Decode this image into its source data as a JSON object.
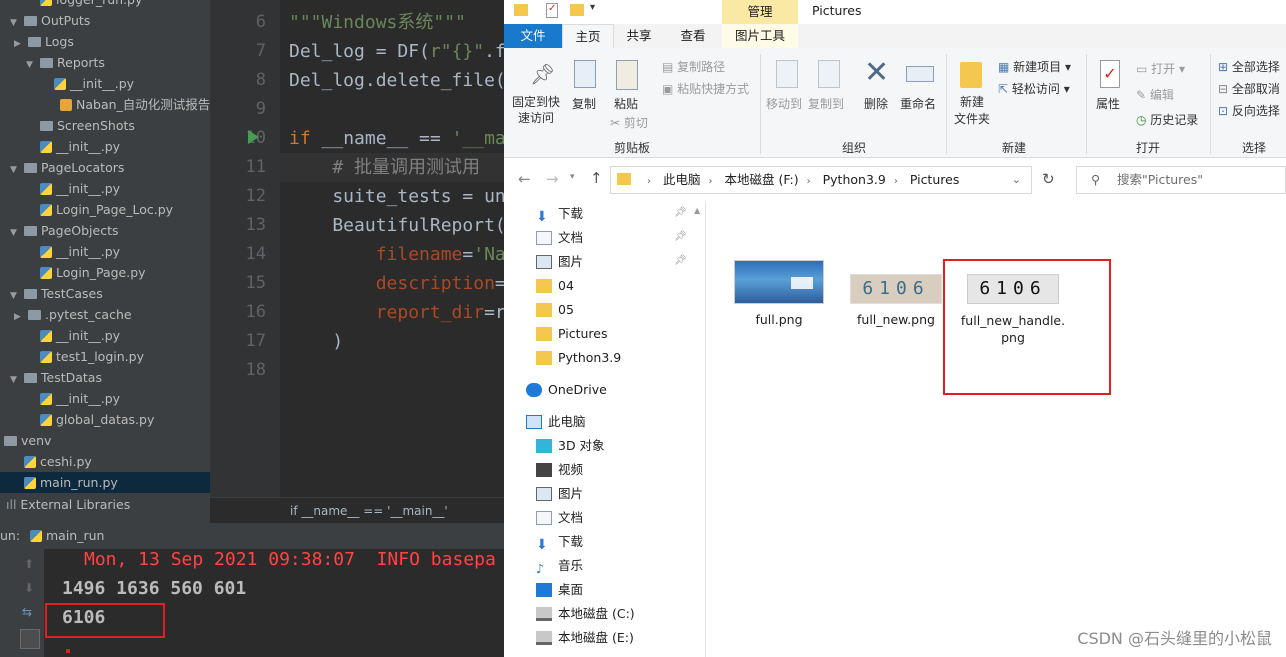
{
  "ide": {
    "tree": [
      {
        "label": "logger_run.py",
        "kind": "py"
      },
      {
        "label": "OutPuts",
        "kind": "folder",
        "arrow": "▼"
      },
      {
        "label": "Logs",
        "kind": "folder",
        "arrow": "▶"
      },
      {
        "label": "Reports",
        "kind": "folder",
        "arrow": "▼"
      },
      {
        "label": "__init__.py",
        "kind": "py"
      },
      {
        "label": "Naban_自动化测试报告.h",
        "kind": "file"
      },
      {
        "label": "ScreenShots",
        "kind": "folder"
      },
      {
        "label": "__init__.py",
        "kind": "py"
      },
      {
        "label": "PageLocators",
        "kind": "folder",
        "arrow": "▼"
      },
      {
        "label": "__init__.py",
        "kind": "py"
      },
      {
        "label": "Login_Page_Loc.py",
        "kind": "py"
      },
      {
        "label": "PageObjects",
        "kind": "folder",
        "arrow": "▼"
      },
      {
        "label": "__init__.py",
        "kind": "py"
      },
      {
        "label": "Login_Page.py",
        "kind": "py"
      },
      {
        "label": "TestCases",
        "kind": "folder",
        "arrow": "▼"
      },
      {
        "label": ".pytest_cache",
        "kind": "folder",
        "arrow": "▶"
      },
      {
        "label": "__init__.py",
        "kind": "py"
      },
      {
        "label": "test1_login.py",
        "kind": "py"
      },
      {
        "label": "TestDatas",
        "kind": "folder",
        "arrow": "▼"
      },
      {
        "label": "__init__.py",
        "kind": "py"
      },
      {
        "label": "global_datas.py",
        "kind": "py"
      },
      {
        "label": "venv",
        "kind": "folder",
        "arrow": "▶"
      },
      {
        "label": "ceshi.py",
        "kind": "py"
      },
      {
        "label": "main_run.py",
        "kind": "py",
        "selected": true
      }
    ],
    "external_libraries": "External Libraries",
    "line_numbers": [
      "6",
      "7",
      "8",
      "9",
      "10",
      "11",
      "12",
      "13",
      "14",
      "15",
      "16",
      "17",
      "18"
    ],
    "code_lines": [
      [
        {
          "t": "\"\"\"Windows系统\"\"\"",
          "c": "str"
        }
      ],
      [
        {
          "t": "Del_log = DF(",
          "c": "fn"
        },
        {
          "t": "r\"{}\"",
          "c": "str"
        },
        {
          "t": ".f",
          "c": "fn"
        }
      ],
      [
        {
          "t": "Del_log.delete_file(",
          "c": "fn"
        }
      ],
      [],
      [
        {
          "t": "if ",
          "c": "kw"
        },
        {
          "t": "__name__ == ",
          "c": "fn"
        },
        {
          "t": "'__ma",
          "c": "str"
        }
      ],
      [
        {
          "t": "    # 批量调用测试用",
          "c": "cm"
        }
      ],
      [
        {
          "t": "    suite_tests = un",
          "c": "fn"
        }
      ],
      [
        {
          "t": "    BeautifulReport(",
          "c": "fn"
        }
      ],
      [
        {
          "t": "        ",
          "c": "fn"
        },
        {
          "t": "filename",
          "c": "prm"
        },
        {
          "t": "=",
          "c": "fn"
        },
        {
          "t": "'Na",
          "c": "str"
        }
      ],
      [
        {
          "t": "        ",
          "c": "fn"
        },
        {
          "t": "description",
          "c": "prm"
        },
        {
          "t": "=",
          "c": "fn"
        }
      ],
      [
        {
          "t": "        ",
          "c": "fn"
        },
        {
          "t": "report_dir",
          "c": "prm"
        },
        {
          "t": "=r",
          "c": "fn"
        }
      ],
      [
        {
          "t": "    )",
          "c": "fn"
        }
      ],
      []
    ],
    "breadcrumb": "if __name__ == '__main__'",
    "run_label": "un:",
    "run_tab": "main_run",
    "console": {
      "log_line": "Mon, 13 Sep 2021 09:38:07  INFO basepa",
      "coords_line": "1496 1636 560 601",
      "result_line": "6106"
    }
  },
  "explorer": {
    "manage_tab": "管理",
    "window_title": "Pictures",
    "tabs": [
      "文件",
      "主页",
      "共享",
      "查看",
      "图片工具"
    ],
    "ribbon": {
      "pin": "固定到快\n速访问",
      "copy": "复制",
      "paste": "粘贴",
      "copy_path": "复制路径",
      "paste_shortcut": "粘贴快捷方式",
      "cut": "剪切",
      "move_to": "移动到",
      "copy_to": "复制到",
      "delete": "删除",
      "rename": "重命名",
      "new_folder": "新建\n文件夹",
      "new_item": "新建项目 ▾",
      "easy_access": "轻松访问 ▾",
      "properties": "属性",
      "open": "打开 ▾",
      "edit": "编辑",
      "history": "历史记录",
      "select_all": "全部选择",
      "select_none": "全部取消",
      "invert": "反向选择",
      "groups": [
        "剪贴板",
        "组织",
        "新建",
        "打开",
        "选择"
      ]
    },
    "path": [
      "此电脑",
      "本地磁盘 (F:)",
      "Python3.9",
      "Pictures"
    ],
    "search_placeholder": "搜索\"Pictures\"",
    "nav": [
      {
        "label": "下载",
        "icon": "download-icon",
        "pin": true
      },
      {
        "label": "文档",
        "icon": "document-icon",
        "pin": true
      },
      {
        "label": "图片",
        "icon": "picture-icon",
        "pin": true
      },
      {
        "label": "04",
        "icon": "folder-icon"
      },
      {
        "label": "05",
        "icon": "folder-icon"
      },
      {
        "label": "Pictures",
        "icon": "folder-icon"
      },
      {
        "label": "Python3.9",
        "icon": "folder-icon"
      },
      {
        "label": "OneDrive",
        "icon": "onedrive-icon"
      },
      {
        "label": "此电脑",
        "icon": "computer-icon"
      },
      {
        "label": "3D 对象",
        "icon": "3d-objects-icon"
      },
      {
        "label": "视频",
        "icon": "video-icon"
      },
      {
        "label": "图片",
        "icon": "picture-icon"
      },
      {
        "label": "文档",
        "icon": "document-icon"
      },
      {
        "label": "下载",
        "icon": "download-icon"
      },
      {
        "label": "音乐",
        "icon": "music-icon"
      },
      {
        "label": "桌面",
        "icon": "desktop-icon"
      },
      {
        "label": "本地磁盘 (C:)",
        "icon": "drive-icon"
      },
      {
        "label": "本地磁盘 (E:)",
        "icon": "drive-icon"
      }
    ],
    "files": [
      {
        "name": "full.png"
      },
      {
        "name": "full_new.png",
        "thumb_text": "6106"
      },
      {
        "name": "full_new_handle.\npng",
        "thumb_text": "6106"
      }
    ]
  },
  "watermark": "CSDN @石头缝里的小松鼠"
}
